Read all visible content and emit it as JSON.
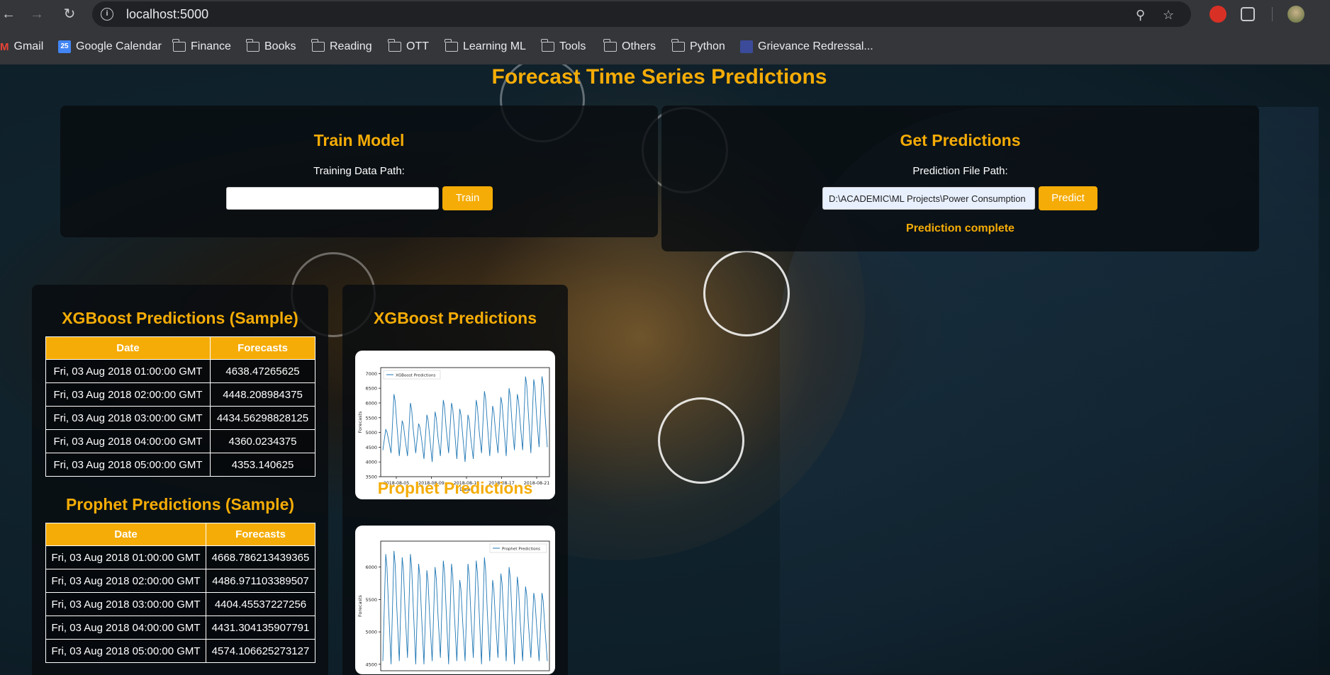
{
  "browser": {
    "url": "localhost:5000",
    "bookmarks": [
      {
        "label": "Gmail",
        "icon": "gmail-icon"
      },
      {
        "label": "Google Calendar",
        "icon": "calendar-icon"
      },
      {
        "label": "Finance",
        "icon": "folder-icon"
      },
      {
        "label": "Books",
        "icon": "folder-icon"
      },
      {
        "label": "Reading",
        "icon": "folder-icon"
      },
      {
        "label": "OTT",
        "icon": "folder-icon"
      },
      {
        "label": "Learning ML",
        "icon": "folder-icon"
      },
      {
        "label": "Tools",
        "icon": "folder-icon"
      },
      {
        "label": "Others",
        "icon": "folder-icon"
      },
      {
        "label": "Python",
        "icon": "folder-icon"
      },
      {
        "label": "Grievance Redressal...",
        "icon": "grievance-site-icon"
      }
    ],
    "calendar_badge": "25"
  },
  "page": {
    "title": "Forecast Time Series Predictions",
    "train": {
      "title": "Train Model",
      "label": "Training Data Path:",
      "value": "",
      "button": "Train"
    },
    "predict": {
      "title": "Get Predictions",
      "label": "Prediction File Path:",
      "value": "D:\\ACADEMIC\\ML Projects\\Power Consumption Fc",
      "button": "Predict",
      "status": "Prediction complete"
    },
    "xgb_table": {
      "title": "XGBoost Predictions (Sample)",
      "headers": [
        "Date",
        "Forecasts"
      ],
      "rows": [
        [
          "Fri, 03 Aug 2018 01:00:00 GMT",
          "4638.47265625"
        ],
        [
          "Fri, 03 Aug 2018 02:00:00 GMT",
          "4448.208984375"
        ],
        [
          "Fri, 03 Aug 2018 03:00:00 GMT",
          "4434.56298828125"
        ],
        [
          "Fri, 03 Aug 2018 04:00:00 GMT",
          "4360.0234375"
        ],
        [
          "Fri, 03 Aug 2018 05:00:00 GMT",
          "4353.140625"
        ]
      ]
    },
    "prophet_table": {
      "title": "Prophet Predictions (Sample)",
      "headers": [
        "Date",
        "Forecasts"
      ],
      "rows": [
        [
          "Fri, 03 Aug 2018 01:00:00 GMT",
          "4668.786213439365"
        ],
        [
          "Fri, 03 Aug 2018 02:00:00 GMT",
          "4486.971103389507"
        ],
        [
          "Fri, 03 Aug 2018 03:00:00 GMT",
          "4404.45537227256"
        ],
        [
          "Fri, 03 Aug 2018 04:00:00 GMT",
          "4431.304135907791"
        ],
        [
          "Fri, 03 Aug 2018 05:00:00 GMT",
          "4574.106625273127"
        ]
      ]
    },
    "xgb_plot_title": "XGBoost Predictions",
    "prophet_plot_title": "Prophet Predictions"
  },
  "chart_data": [
    {
      "type": "line",
      "legend": "XGBoost Predictions",
      "legend_position": "top-left",
      "xlabel": "Date",
      "ylabel": "Forecasts",
      "ylim": [
        3500,
        7200
      ],
      "yticks": [
        "3500",
        "4000",
        "4500",
        "5000",
        "5500",
        "6000",
        "6500",
        "7000"
      ],
      "xticks": [
        "2018-08-05",
        "2018-08-09",
        "2018-08-13",
        "2018-08-17",
        "2018-08-21"
      ],
      "x_start": "2018-08-03",
      "x_end": "2018-08-22",
      "daily_peaks": [
        5100,
        6300,
        5400,
        6000,
        5300,
        5600,
        5700,
        6100,
        6000,
        5800,
        5600,
        6100,
        6400,
        5900,
        6200,
        6500,
        6300,
        6900,
        6800,
        6900
      ],
      "daily_troughs": [
        4400,
        4300,
        4200,
        4200,
        4300,
        4100,
        4000,
        4200,
        4300,
        4100,
        4000,
        4100,
        4300,
        4200,
        4300,
        4200,
        4400,
        4400,
        4300,
        4500
      ],
      "color": "#1f77b4"
    },
    {
      "type": "line",
      "legend": "Prophet Predictions",
      "legend_position": "top-right",
      "xlabel": "",
      "ylabel": "Forecasts",
      "ylim": [
        4400,
        6400
      ],
      "yticks": [
        "4500",
        "5000",
        "5500",
        "6000"
      ],
      "daily_peaks": [
        6200,
        6250,
        6150,
        6200,
        6050,
        5950,
        6000,
        6100,
        6050,
        5800,
        6050,
        6100,
        6150,
        5800,
        5900,
        6000,
        5850,
        5700,
        5600,
        5600
      ],
      "daily_troughs": [
        4550,
        4500,
        4550,
        4600,
        4500,
        4500,
        4550,
        4600,
        4500,
        4550,
        4550,
        4600,
        4500,
        4550,
        4600,
        4550,
        4500,
        4550,
        4600,
        4550
      ],
      "color": "#1f77b4"
    }
  ]
}
